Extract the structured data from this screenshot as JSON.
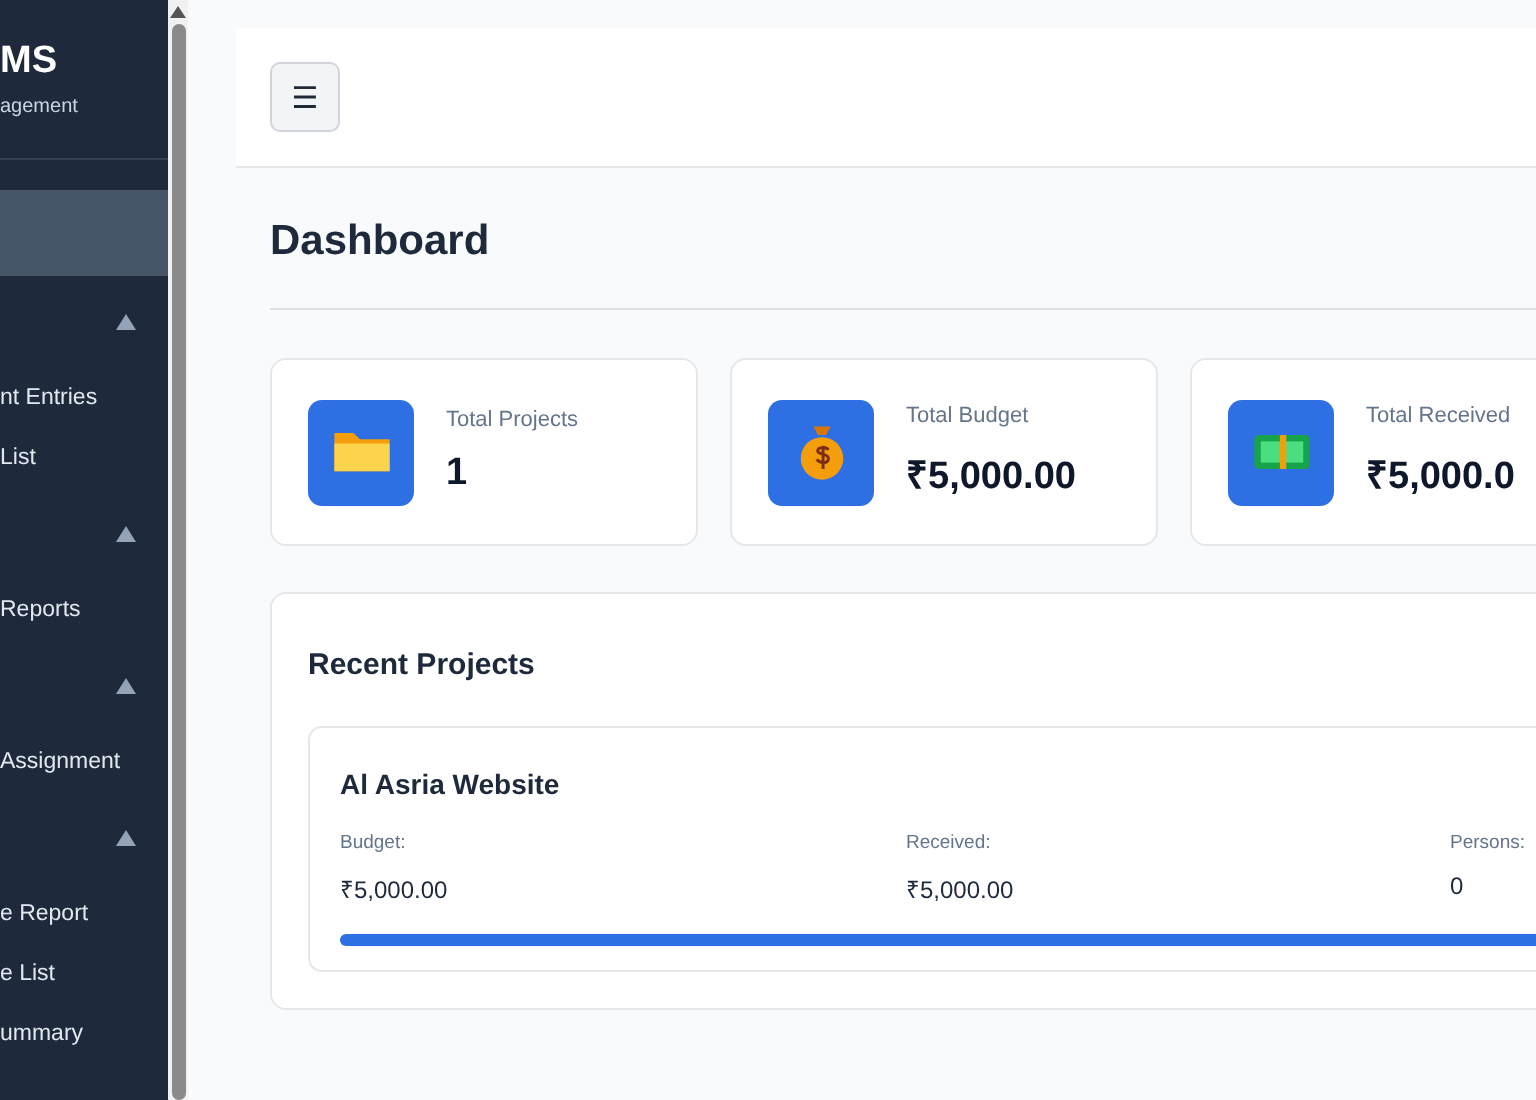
{
  "sidebar": {
    "brand": "MS",
    "subtitle": "agement",
    "items": [
      {
        "kind": "link",
        "selected": true
      },
      {
        "kind": "section",
        "expanded": true
      },
      {
        "kind": "link",
        "label": "nt Entries",
        "selected": false
      },
      {
        "kind": "link",
        "label": "List",
        "selected": false
      },
      {
        "kind": "section",
        "expanded": true
      },
      {
        "kind": "link",
        "label": "Reports",
        "selected": false
      },
      {
        "kind": "section",
        "expanded": true
      },
      {
        "kind": "link",
        "label": "Assignment",
        "selected": false
      },
      {
        "kind": "section",
        "expanded": true
      },
      {
        "kind": "link",
        "label": "e Report",
        "selected": false
      },
      {
        "kind": "link",
        "label": "e List",
        "selected": false
      },
      {
        "kind": "link",
        "label": "ummary",
        "selected": false
      }
    ]
  },
  "header": {
    "menu_button": "☰"
  },
  "page_title": "Dashboard",
  "stats": [
    {
      "kind": "folder",
      "label": "Total Projects",
      "value": "1"
    },
    {
      "kind": "moneybag",
      "label": "Total Budget",
      "value": "₹5,000.00"
    },
    {
      "kind": "cash",
      "label": "Total Received",
      "value": "₹5,000.0"
    }
  ],
  "recent_projects": {
    "title": "Recent Projects",
    "projects": [
      {
        "name": "Al Asria Website",
        "fields": [
          {
            "label": "Budget:",
            "value": "₹5,000.00"
          },
          {
            "label": "Received:",
            "value": "₹5,000.00"
          },
          {
            "label": "Persons:",
            "value": "0"
          }
        ],
        "level": 1
      }
    ]
  }
}
